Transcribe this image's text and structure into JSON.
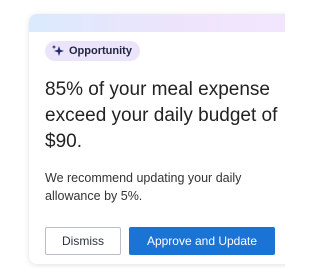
{
  "card": {
    "badge": {
      "icon": "sparkle-icon",
      "label": "Opportunity"
    },
    "headline": "85% of your meal expense exceed your daily budget of $90.",
    "body": "We recommend updating your daily allowance by 5%.",
    "actions": {
      "dismiss_label": "Dismiss",
      "approve_label": "Approve and Update"
    }
  },
  "colors": {
    "badge_bg": "#ece4fb",
    "primary_button": "#1b73d6",
    "gradient_start": "#dbeafe",
    "gradient_end": "#f3e6ff"
  }
}
